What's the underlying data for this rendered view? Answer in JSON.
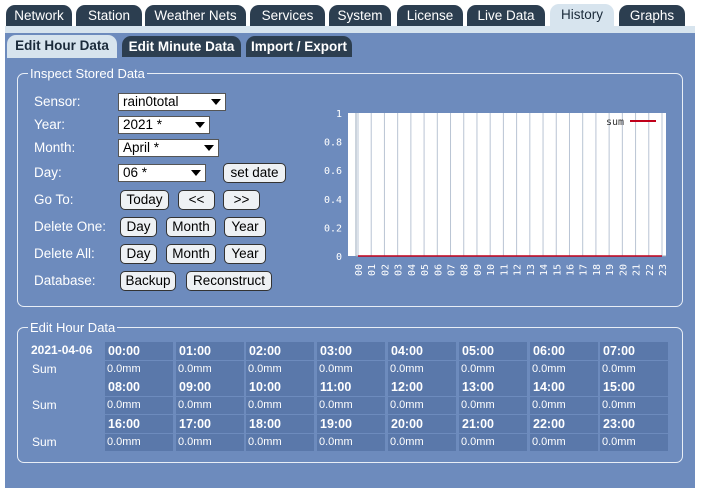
{
  "main_tabs": [
    "Network",
    "Station",
    "Weather Nets",
    "Services",
    "System",
    "License",
    "Live Data",
    "History",
    "Graphs"
  ],
  "sub_tabs": [
    "Edit Hour Data",
    "Edit Minute Data",
    "Import / Export"
  ],
  "inspect": {
    "legend": "Inspect Stored Data",
    "sensor_label": "Sensor:",
    "sensor_value": "rain0total",
    "year_label": "Year:",
    "year_value": "2021 *",
    "month_label": "Month:",
    "month_value": "April *",
    "day_label": "Day:",
    "day_value": "06 *",
    "set_date": "set date",
    "goto_label": "Go To:",
    "today": "Today",
    "prev": "<<",
    "next": ">>",
    "delete_one_label": "Delete One:",
    "delete_all_label": "Delete All:",
    "day_btn": "Day",
    "month_btn": "Month",
    "year_btn": "Year",
    "database_label": "Database:",
    "backup": "Backup",
    "reconstruct": "Reconstruct"
  },
  "chart_data": {
    "type": "line",
    "x": [
      "00",
      "01",
      "02",
      "03",
      "04",
      "05",
      "06",
      "07",
      "08",
      "09",
      "10",
      "11",
      "12",
      "13",
      "14",
      "15",
      "16",
      "17",
      "18",
      "19",
      "20",
      "21",
      "22",
      "23"
    ],
    "y_ticks": [
      "0",
      "0.2",
      "0.4",
      "0.6",
      "0.8",
      "1"
    ],
    "ylim": [
      0,
      1
    ],
    "series": [
      {
        "name": "sum",
        "values": [
          0,
          0,
          0,
          0,
          0,
          0,
          0,
          0,
          0,
          0,
          0,
          0,
          0,
          0,
          0,
          0,
          0,
          0,
          0,
          0,
          0,
          0,
          0,
          0
        ],
        "color": "#c0001a"
      }
    ],
    "grid": true,
    "legend": "top-right"
  },
  "edit": {
    "legend": "Edit Hour Data",
    "date": "2021-04-06",
    "sum_label": "Sum",
    "hours": [
      "00:00",
      "01:00",
      "02:00",
      "03:00",
      "04:00",
      "05:00",
      "06:00",
      "07:00",
      "08:00",
      "09:00",
      "10:00",
      "11:00",
      "12:00",
      "13:00",
      "14:00",
      "15:00",
      "16:00",
      "17:00",
      "18:00",
      "19:00",
      "20:00",
      "21:00",
      "22:00",
      "23:00"
    ],
    "values": [
      "0.0mm",
      "0.0mm",
      "0.0mm",
      "0.0mm",
      "0.0mm",
      "0.0mm",
      "0.0mm",
      "0.0mm",
      "0.0mm",
      "0.0mm",
      "0.0mm",
      "0.0mm",
      "0.0mm",
      "0.0mm",
      "0.0mm",
      "0.0mm",
      "0.0mm",
      "0.0mm",
      "0.0mm",
      "0.0mm",
      "0.0mm",
      "0.0mm",
      "0.0mm",
      "0.0mm"
    ]
  },
  "colors": {
    "panel": "#6d8bbd",
    "tab_dark": "#2c3e50",
    "tab_active": "#d7e4ee",
    "cell": "#5a78aa",
    "series": "#c0001a"
  }
}
